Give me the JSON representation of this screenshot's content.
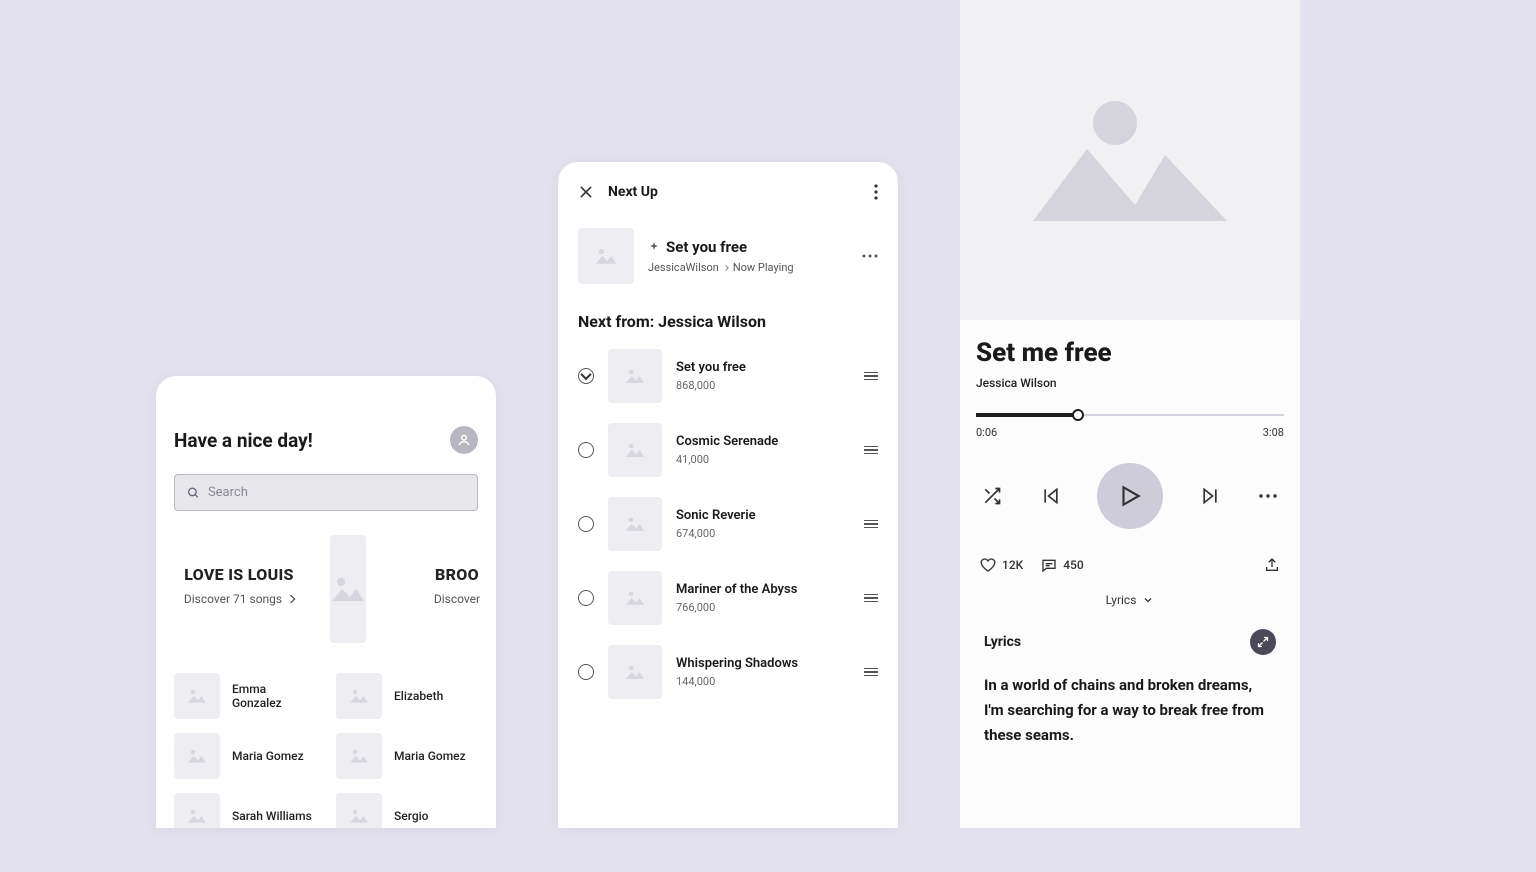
{
  "discover": {
    "greeting": "Have a nice day!",
    "search_placeholder": "Search",
    "featured": [
      {
        "title": "LOVE IS LOUIS",
        "subtitle": "Discover 71 songs"
      },
      {
        "title": "BROO",
        "subtitle": "Discover"
      }
    ],
    "artists": [
      "Emma Gonzalez",
      "Elizabeth",
      "Maria Gomez",
      "Maria Gomez",
      "Sarah Williams",
      "Sergio"
    ]
  },
  "queue": {
    "header": "Next Up",
    "now_playing": {
      "title": "Set you free",
      "artist": "JessicaWilson",
      "status": "Now Playing"
    },
    "next_from": "Next from: Jessica Wilson",
    "items": [
      {
        "title": "Set you free",
        "plays": "868,000",
        "checked": true
      },
      {
        "title": "Cosmic Serenade",
        "plays": "41,000",
        "checked": false
      },
      {
        "title": "Sonic Reverie",
        "plays": "674,000",
        "checked": false
      },
      {
        "title": "Mariner of the Abyss",
        "plays": "766,000",
        "checked": false
      },
      {
        "title": "Whispering Shadows",
        "plays": "144,000",
        "checked": false
      }
    ]
  },
  "player": {
    "title": "Set me free",
    "artist": "Jessica Wilson",
    "time_elapsed": "0:06",
    "time_total": "3:08",
    "likes": "12K",
    "comments": "450",
    "lyrics_toggle": "Lyrics",
    "lyrics_heading": "Lyrics",
    "lyrics_text": "In a world of chains and broken dreams,\nI'm searching for a way to break free from these seams."
  }
}
